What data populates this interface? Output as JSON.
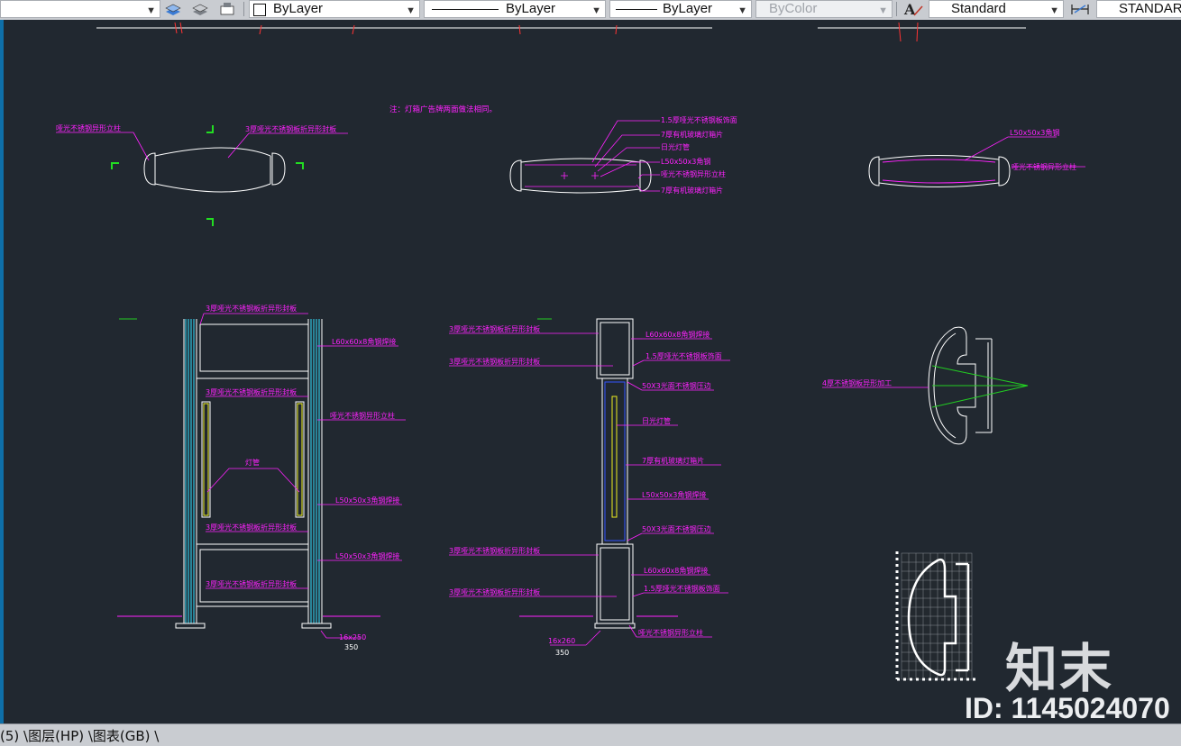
{
  "toolbar": {
    "color_combo": "ByLayer",
    "linetype_combo": "ByLayer",
    "lineweight_combo": "ByLayer",
    "plotstyle_combo": "ByColor",
    "textstyle_combo": "Standard",
    "dimstyle_combo": "STANDAR"
  },
  "layout_tabs": "(5) \\图层(HP) \\图表(GB) \\",
  "watermark": {
    "logo": "知末",
    "id": "ID: 1145024070"
  },
  "drawing": {
    "note_top": "注：灯箱广告牌两面做法相同。",
    "plan_left": {
      "label_a": "哑光不锈钢异形立柱",
      "label_b": "3厚哑光不锈钢板折异形封板"
    },
    "plan_mid": {
      "label_1": "1.5厚哑光不锈钢板饰面",
      "label_2": "7厚有机玻璃灯箱片",
      "label_3": "日光灯管",
      "label_4": "L50x50x3角钢",
      "label_5": "哑光不锈钢异形立柱",
      "label_6": "7厚有机玻璃灯箱片"
    },
    "plan_right": {
      "label_1": "L50x50x3角钢",
      "label_2": "哑光不锈钢异形立柱"
    },
    "elev_left": {
      "label_1": "3厚哑光不锈钢板折异形封板",
      "label_2": "L60x60x8角钢焊接",
      "label_3": "3厚哑光不锈钢板折异形封板",
      "label_4": "哑光不锈钢异形立柱",
      "label_5": "灯管",
      "label_6": "L50x50x3角钢焊接",
      "label_7": "3厚哑光不锈钢板折异形封板",
      "label_8": "L50x50x3角钢焊接",
      "label_9": "3厚哑光不锈钢板折异形封板",
      "dim_a": "16x250",
      "dim_b": "350"
    },
    "section_mid": {
      "label_l1": "3厚哑光不锈钢板折异形封板",
      "label_l2": "3厚哑光不锈钢板折异形封板",
      "label_l3": "3厚哑光不锈钢板折异形封板",
      "label_l4": "3厚哑光不锈钢板折异形封板",
      "label_r1": "L60x60x8角钢焊接",
      "label_r2": "1.5厚哑光不锈钢板饰面",
      "label_r3": "50X3光面不锈钢压边",
      "label_r4": "日光灯管",
      "label_r5": "7厚有机玻璃灯箱片",
      "label_r6": "L50x50x3角钢焊接",
      "label_r7": "50X3光面不锈钢压边",
      "label_r8": "L60x60x8角钢焊接",
      "label_r9": "1.5厚哑光不锈钢板饰面",
      "label_r10": "哑光不锈钢异形立柱",
      "dim_a": "16x260",
      "dim_b": "350"
    },
    "detail_right": {
      "label_1": "4厚不锈钢板异形加工"
    }
  },
  "colors": {
    "canvas": "#212830",
    "magenta": "#ff22ff",
    "cyan": "#33e0ff",
    "yellow": "#f0f020",
    "green": "#22cc22",
    "white": "#ffffff"
  }
}
